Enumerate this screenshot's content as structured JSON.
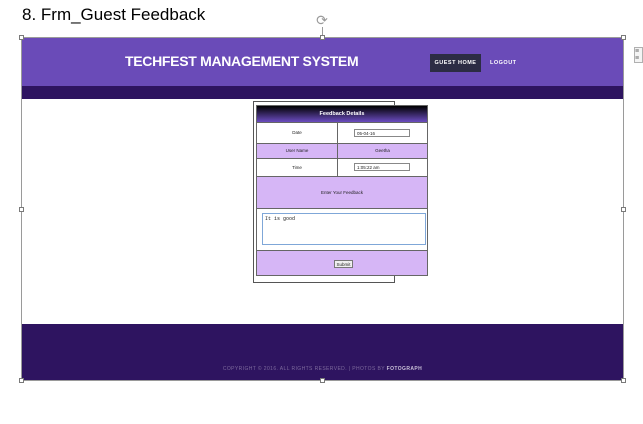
{
  "caption": "8. Frm_Guest Feedback",
  "site": {
    "title": "TECHFEST MANAGEMENT SYSTEM",
    "nav": {
      "home": "GUEST HOME",
      "logout": "LOGOUT"
    }
  },
  "form": {
    "heading": "Feedback Details",
    "date_label": "Date",
    "date_value": "05-04-16",
    "username_label": "User Name",
    "username_value": "Geetha",
    "time_label": "Time",
    "time_value": "1:05:22 am",
    "feedback_prompt": "Enter Your Feedback",
    "feedback_text": "It is good",
    "submit_label": "Submit"
  },
  "footer": {
    "copyright": "COPYRIGHT © 2016. ALL RIGHTS RESERVED. | PHOTOS BY",
    "credit": "FOTOGRAPH"
  },
  "colors": {
    "header": "#6a4bb8",
    "dark_band": "#2e1460",
    "row_highlight": "#d6b6f6"
  }
}
